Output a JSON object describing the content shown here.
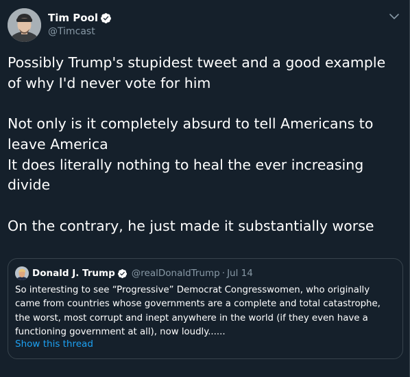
{
  "author": {
    "display_name": "Tim Pool",
    "handle": "@Timcast",
    "verified": true
  },
  "tweet": {
    "text": "Possibly Trump's stupidest tweet and a good example of why I'd never vote for him\n\nNot only is it completely absurd to tell Americans to leave America\nIt does literally nothing to heal the ever increasing divide\n\nOn the contrary, he just made it substantially worse"
  },
  "quoted_tweet": {
    "display_name": "Donald J. Trump",
    "handle": "@realDonaldTrump",
    "separator": "·",
    "date": "Jul 14",
    "verified": true,
    "text": "So interesting to see “Progressive” Democrat Congresswomen, who originally came from countries whose governments are a complete and total catastrophe, the worst, most corrupt and inept anywhere in the world (if they even have a functioning government at all), now loudly......",
    "show_thread_label": "Show this thread"
  },
  "icons": {
    "verified": "verified-badge-icon",
    "more": "chevron-down-icon"
  },
  "colors": {
    "background": "#15202b",
    "text": "#ffffff",
    "secondary_text": "#8899a6",
    "accent": "#1da1f2",
    "border": "#38444d"
  }
}
